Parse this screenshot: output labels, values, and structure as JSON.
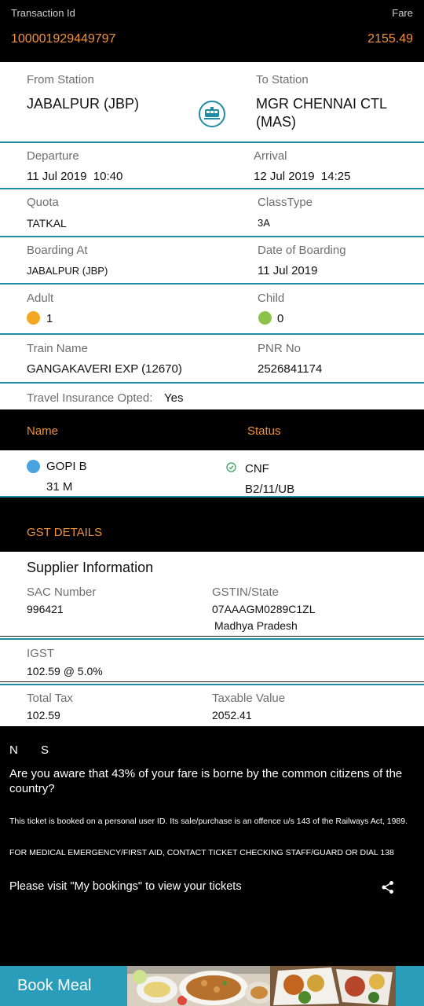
{
  "header": {
    "transaction_label": "Transaction Id",
    "fare_label": "Fare",
    "transaction_id": "100001929449797",
    "fare_value": "2155.49"
  },
  "journey": {
    "from_label": "From Station",
    "from_value": "JABALPUR (JBP)",
    "to_label": "To Station",
    "to_value_line1": "MGR CHENNAI CTL",
    "to_value_line2": "(MAS)",
    "departure_label": "Departure",
    "departure_value": "11 Jul 2019  10:40",
    "arrival_label": "Arrival",
    "arrival_value": "12 Jul 2019  14:25",
    "quota_label": "Quota",
    "quota_value": "TATKAL",
    "class_label": "ClassType",
    "class_value": "3A",
    "boarding_label": "Boarding At",
    "boarding_value": "JABALPUR (JBP)",
    "boarding_date_label": "Date of Boarding",
    "boarding_date_value": "11 Jul 2019",
    "adult_label": "Adult",
    "adult_value": "1",
    "child_label": "Child",
    "child_value": "0",
    "train_label": "Train Name",
    "train_value": "GANGAKAVERI EXP (12670)",
    "pnr_label": "PNR No",
    "pnr_value": "2526841174",
    "insurance_label": "Travel Insurance Opted:",
    "insurance_value": "Yes"
  },
  "passengers": {
    "name_header": "Name",
    "status_header": "Status",
    "rows": [
      {
        "name": "GOPI B",
        "age_gender": "31 M",
        "status": "CNF",
        "berth": "B2/11/UB"
      }
    ]
  },
  "gst": {
    "title": "GST DETAILS",
    "supplier_heading": "Supplier Information",
    "sac_label": "SAC Number",
    "sac_value": "996421",
    "gstin_label": "GSTIN/State",
    "gstin_value": "07AAAGM0289C1ZL",
    "state_value": "Madhya Pradesh",
    "igst_label": "IGST",
    "igst_value": "102.59 @ 5.0%",
    "total_tax_label": "Total Tax",
    "total_tax_value": "102.59",
    "taxable_label": "Taxable Value",
    "taxable_value": "2052.41"
  },
  "notes": {
    "ns_n": "N",
    "ns_s": "S",
    "subsidy_text": "Are you aware that 43% of your fare is borne by the common citizens of the country?",
    "offence_text": "This ticket is booked on a personal user ID. Its sale/purchase is an offence u/s 143 of the Railways Act, 1989.",
    "medical_text": "FOR MEDICAL EMERGENCY/FIRST AID, CONTACT TICKET CHECKING STAFF/GUARD OR DIAL 138",
    "visit_text": "Please visit \"My bookings\" to view your tickets"
  },
  "footer": {
    "book_meal": "Book Meal"
  },
  "colors": {
    "accent_orange": "#f0923a",
    "teal": "#1f8ea3",
    "meal_bar": "#2a9dbb"
  }
}
